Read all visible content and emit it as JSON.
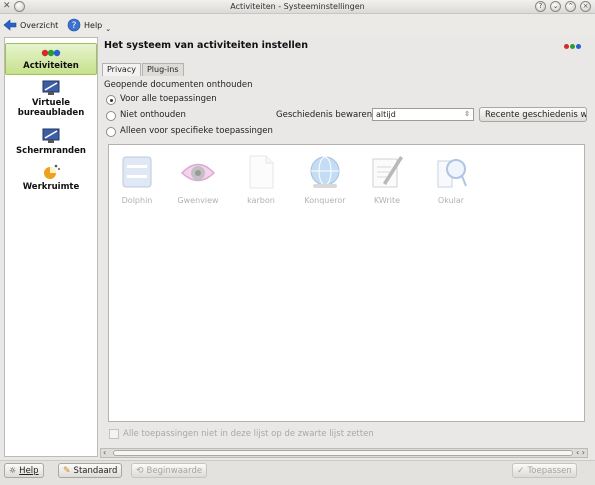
{
  "window": {
    "title": "Activiteiten - Systeeminstellingen"
  },
  "toolbar": {
    "overview_label": "Overzicht",
    "help_label": "Help"
  },
  "sidebar": {
    "items": [
      {
        "label": "Activiteiten",
        "icon": "activities-icon"
      },
      {
        "label": "Virtuele bureaubladen",
        "icon": "virtual-desktops-icon"
      },
      {
        "label": "Schermranden",
        "icon": "screen-edges-icon"
      },
      {
        "label": "Werkruimte",
        "icon": "workspace-icon"
      }
    ]
  },
  "main": {
    "heading": "Het systeem van activiteiten instellen",
    "tabs": [
      {
        "label": "Privacy"
      },
      {
        "label": "Plug-ins"
      }
    ],
    "section_label": "Geopende documenten onthouden",
    "options": [
      {
        "label": "Voor alle toepassingen",
        "checked": true
      },
      {
        "label": "Niet onthouden",
        "checked": false
      },
      {
        "label": "Alleen voor specifieke toepassingen",
        "checked": false
      }
    ],
    "history_label": "Geschiedenis bewaren",
    "history_value": "altijd",
    "clear_history_button": "Recente geschiedenis wi",
    "apps": [
      {
        "label": "Dolphin",
        "icon": "dolphin-icon"
      },
      {
        "label": "Gwenview",
        "icon": "gwenview-icon"
      },
      {
        "label": "karbon",
        "icon": "karbon-icon"
      },
      {
        "label": "Konqueror",
        "icon": "konqueror-icon"
      },
      {
        "label": "KWrite",
        "icon": "kwrite-icon"
      },
      {
        "label": "Okular",
        "icon": "okular-icon"
      }
    ],
    "blacklist_checkbox_label": "Alle toepassingen niet in deze lijst op de zwarte lijst zetten"
  },
  "footer": {
    "help_button": "Help",
    "default_button": "Standaard",
    "reset_button": "Beginwaarde",
    "apply_button": "Toepassen"
  },
  "colors": {
    "accent_green": "#c6e28c",
    "activity_red": "#d42a2a",
    "activity_green": "#2f9a38",
    "activity_blue": "#2a5fcf"
  }
}
